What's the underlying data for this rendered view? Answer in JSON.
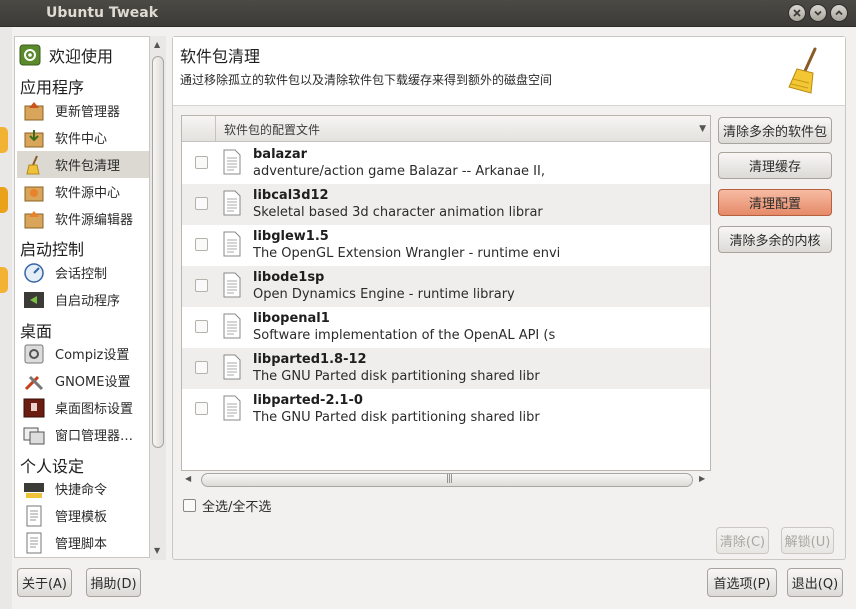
{
  "window": {
    "title": "Ubuntu Tweak"
  },
  "sidebar": {
    "top_item": "欢迎使用",
    "sections": [
      {
        "title": "应用程序",
        "items": [
          "更新管理器",
          "软件中心",
          "软件包清理",
          "软件源中心",
          "软件源编辑器"
        ]
      },
      {
        "title": "启动控制",
        "items": [
          "会话控制",
          "自启动程序"
        ]
      },
      {
        "title": "桌面",
        "items": [
          "Compiz设置",
          "GNOME设置",
          "桌面图标设置",
          "窗口管理器…"
        ]
      },
      {
        "title": "个人设定",
        "items": [
          "快捷命令",
          "管理模板",
          "管理脚本"
        ]
      }
    ],
    "selected": "软件包清理"
  },
  "header": {
    "title": "软件包清理",
    "subtitle": "通过移除孤立的软件包以及清除软件包下载缓存来得到额外的磁盘空间"
  },
  "package_list": {
    "column_header": "软件包的配置文件",
    "rows": [
      {
        "name": "balazar",
        "desc": "adventure/action game Balazar -- Arkanae II,"
      },
      {
        "name": "libcal3d12",
        "desc": "Skeletal based 3d character animation librar"
      },
      {
        "name": "libglew1.5",
        "desc": "The OpenGL Extension Wrangler - runtime envi"
      },
      {
        "name": "libode1sp",
        "desc": "Open Dynamics Engine - runtime library"
      },
      {
        "name": "libopenal1",
        "desc": "Software implementation of the OpenAL API (s"
      },
      {
        "name": "libparted1.8-12",
        "desc": "The GNU Parted disk partitioning shared libr"
      },
      {
        "name": "libparted-2.1-0",
        "desc": "The GNU Parted disk partitioning shared libr"
      }
    ]
  },
  "select_all_label": "全选/全不选",
  "actions": {
    "clean_packages": "清除多余的软件包",
    "clean_cache": "清理缓存",
    "clean_config": "清理配置",
    "clean_kernel": "清除多余的内核"
  },
  "bottom_actions": {
    "clean": "清除(C)",
    "unlock": "解锁(U)",
    "about": "关于(A)",
    "donate": "捐助(D)",
    "preferences": "首选项(P)",
    "quit": "退出(Q)"
  },
  "colors": {
    "highlight_button": "#e68a68",
    "titlebar": "#3c3b37"
  }
}
